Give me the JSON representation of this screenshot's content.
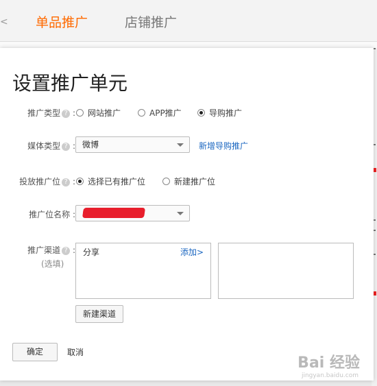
{
  "background": {
    "tabs": [
      {
        "label": "单品推广",
        "active": true
      },
      {
        "label": "店铺推广",
        "active": false
      }
    ],
    "colors": {
      "accent": "#ff6a00",
      "link": "#1a66c0",
      "redaction": "#e81e2c"
    }
  },
  "modal": {
    "title": "设置推广单元",
    "rows": {
      "type": {
        "label": "推广类型",
        "options": [
          {
            "label": "网站推广",
            "selected": false
          },
          {
            "label": "APP推广",
            "selected": false
          },
          {
            "label": "导购推广",
            "selected": true
          }
        ]
      },
      "media": {
        "label": "媒体类型",
        "select_value": "微博",
        "link": "新增导购推广"
      },
      "position": {
        "label": "投放推广位",
        "options": [
          {
            "label": "选择已有推广位",
            "selected": true
          },
          {
            "label": "新建推广位",
            "selected": false
          }
        ]
      },
      "position_name": {
        "label": "推广位名称",
        "select_value": "[redacted]"
      },
      "channel": {
        "label": "推广渠道",
        "optional": "(选填)",
        "left_item": "分享",
        "add_link": "添加>",
        "new_button": "新建渠道"
      }
    },
    "confirm": "确定",
    "cancel": "取消"
  },
  "watermark": {
    "main": "Bai 经验",
    "sub": "jingyan.baidu.com"
  }
}
